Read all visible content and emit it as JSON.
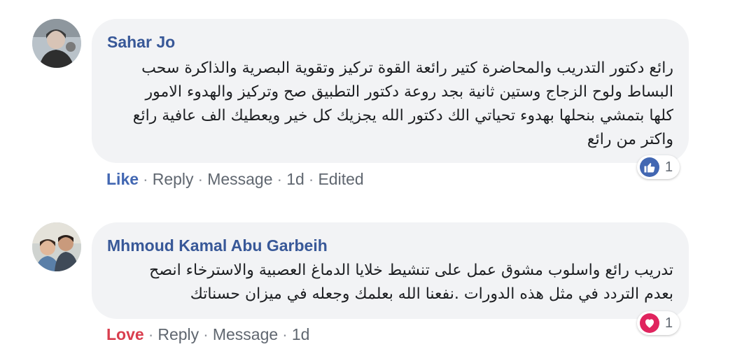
{
  "comments": [
    {
      "author": "Sahar Jo",
      "lines": [
        "رائع دكتور التدريب والمحاضرة كتير رائعة القوة تركيز وتقوية البصرية والذاكرة سحب",
        "البساط ولوح الزجاج وستين ثانية بجد روعة دكتور التطبيق صح وتركيز والهدوء الامور",
        "كلها بتمشي بنحلها بهدوء تحياتي الك دكتور الله يجزيك كل خير ويعطيك الف عافية رائع",
        "واكتر من رائع"
      ],
      "actions": {
        "reaction_label": "Like",
        "reply": "Reply",
        "message": "Message",
        "time": "1d",
        "edited": "Edited"
      },
      "reaction": {
        "icon": "thumbs-up-icon",
        "count": "1",
        "color": "#4267b2"
      }
    },
    {
      "author": "Mhmoud Kamal Abu Garbeih",
      "lines": [
        "تدريب رائع واسلوب مشوق عمل على تنشيط خلايا الدماغ العصبية والاسترخاء انصح",
        "بعدم التردد في مثل هذه الدورات .نفعنا الله بعلمك وجعله في ميزان حسناتك"
      ],
      "actions": {
        "reaction_label": "Love",
        "reply": "Reply",
        "message": "Message",
        "time": "1d"
      },
      "reaction": {
        "icon": "heart-icon",
        "count": "1",
        "color": "#e0245e"
      }
    }
  ],
  "separator": "·"
}
